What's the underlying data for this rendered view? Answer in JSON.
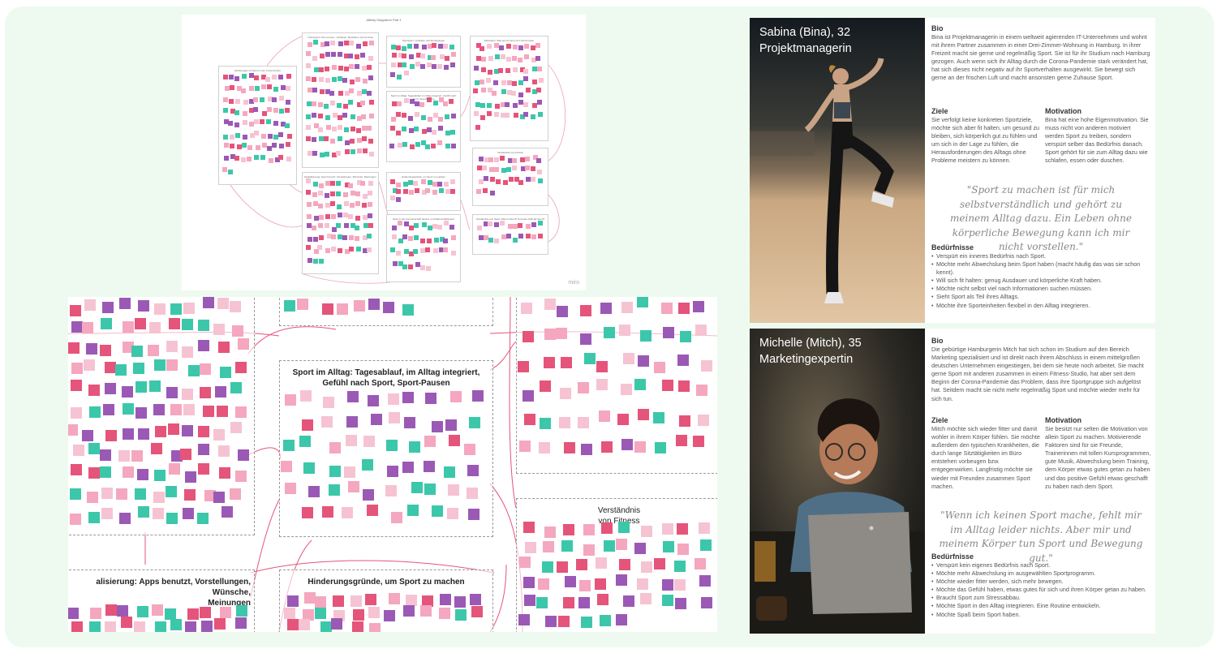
{
  "overview": {
    "title": "Affinity Diagramm Part 1",
    "watermark": "miro",
    "clusters": [
      {
        "label": "Erfahrungen mit Sport in der Covid-19-Zeit"
      },
      {
        "label": "Trainingsort: Wo und wie - Vorlieben, Motivation, Hemmnisse"
      },
      {
        "label": "Sportarten: Vorlieben und Abneigungen"
      },
      {
        "label": "Motivation: Was spornt einen an? Hemmnisse"
      },
      {
        "label": "Sport im Alltag: Tagesablauf, im Alltag integriert, Gefühl nach Sport, Sport-Pausen"
      },
      {
        "label": "Verständnis von Fitness"
      },
      {
        "label": "Digitalisierung: Apps benutzt, Vorstellungen, Wünsche, Meinungen"
      },
      {
        "label": "Hinderungsgründe, um Sport zu machen"
      },
      {
        "label": "Sport in der Gemeinschaft: Einzel- und Mannschaftssport"
      },
      {
        "label": "Verständnis von Sport: Was ist Sport? Und was zählt als Sport?"
      }
    ]
  },
  "zoom": {
    "clusters": [
      {
        "label": "Sport im Alltag: Tagesablauf, im Alltag integriert, Gefühl nach Sport, Sport-Pausen"
      },
      {
        "label": "Verständnis\nvon Fitness"
      },
      {
        "label": "alisierung: Apps benutzt, Vorstellungen, Wünsche,\nMeinungen"
      },
      {
        "label": "Hinderungsgründe, um Sport zu machen"
      }
    ]
  },
  "note_colors": [
    "#e5547a",
    "#f4a7bf",
    "#9b59b6",
    "#3cc7aa",
    "#f6c3d3"
  ],
  "personas": [
    {
      "name_line1": "Sabina (Bina), 32",
      "name_line2": "Projektmanagerin",
      "bio_heading": "Bio",
      "bio": "Bina ist Projektmanagerin in einem weltweit agierenden IT-Unternehmen und wohnt mit ihrem Partner zusammen in einer Drei-Zimmer-Wohnung in Hamburg. In ihrer Freizeit macht sie gerne und regelmäßig Sport. Sie ist für ihr Studium nach Hamburg gezogen. Auch wenn sich ihr Alltag durch die Corona-Pandemie stark verändert hat, hat sich dieses nicht negativ auf ihr Sportverhalten ausgewirkt. Sie bewegt sich gerne an der frischen Luft und macht ansonsten gerne Zuhause Sport.",
      "goals_heading": "Ziele",
      "goals": "Sie verfolgt keine konkreten Sportziele, möchte sich aber fit halten, um gesund zu bleiben, sich körperlich gut zu fühlen und um sich in der Lage zu fühlen, die Herausforderungen des Alltags ohne Probleme meistern zu können.",
      "motivation_heading": "Motivation",
      "motivation": "Bina hat eine hohe Eigenmotivation. Sie muss nicht von anderen motiviert werden Sport zu treiben, sondern verspürt selber das Bedürfnis danach. Sport gehört für sie zum Alltag dazu wie schlafen, essen oder duschen.",
      "quote": "\"Sport zu machen ist für mich selbstverständlich und gehört zu meinem Alltag dazu. Ein Leben ohne körperliche Bewegung kann ich mir nicht vorstellen.\"",
      "needs_heading": "Bedürfnisse",
      "needs": [
        "Verspürt ein inneres Bedürfnis nach Sport.",
        "Möchte mehr Abwechslung beim Sport haben (macht häufig das was sie schon kennt).",
        "Will sich fit halten: genug Ausdauer und körperliche Kraft haben.",
        "Möchte nicht selbst viel nach Informationen suchen müssen.",
        "Sieht Sport als Teil ihres Alltags.",
        "Möchte ihre Sporteinheiten flexibel in den Alltag integrieren."
      ]
    },
    {
      "name_line1": "Michelle (Mitch), 35",
      "name_line2": "Marketingexpertin",
      "bio_heading": "Bio",
      "bio": "Die gebürtige Hamburgerin Mitch hat sich schon im Studium auf den Bereich Marketing spezialisiert und ist direkt nach ihrem Abschluss in einem mittelgroßen deutschen Unternehmen eingestiegen, bei dem sie heute noch arbeitet. Sie macht gerne Sport mit anderen zusammen in einem Fitness-Studio, hat aber seit dem Beginn der Corona-Pandemie das Problem, dass ihre Sportgruppe sich aufgelöst hat. Seitdem macht sie nicht mehr regelmäßig Sport und möchte wieder mehr für sich tun.",
      "goals_heading": "Ziele",
      "goals": "Mitch möchte sich wieder fitter und damit wohler in ihrem Körper fühlen. Sie möchte außerdem den typischen Krankheiten, die durch lange Sitztätigkeiten im Büro entstehen vorbeugen bzw. entgegenwirken. Langfristig möchte sie wieder mit Freunden zusammen Sport machen.",
      "motivation_heading": "Motivation",
      "motivation": "Sie besitzt nur selten die Motivation von allein Sport zu machen. Motivierende Faktoren sind für sie Freunde, Trainerinnen mit tollen Kursprogrammen, gute Musik, Abwechslung beim Training, dem Körper etwas gutes getan zu haben und das positive Gefühl etwas geschafft zu haben nach dem Sport.",
      "quote": "\"Wenn ich keinen Sport mache, fehlt mir im Alltag leider nichts. Aber mir und meinem Körper tun Sport und Bewegung gut.\"",
      "needs_heading": "Bedürfnisse",
      "needs": [
        "Verspürt kein eigenes Bedürfnis nach Sport.",
        "Möchte mehr Abwechslung im ausgewählten Sportprogramm.",
        "Möchte wieder fitter werden, sich mehr bewegen.",
        "Möchte das Gefühl haben, etwas gutes für sich und ihren Körper getan zu haben.",
        "Braucht Sport zum Stressabbau.",
        "Möchte Sport in den Alltag integrieren. Eine Routine entwickeln.",
        "Möchte Spaß beim Sport haben."
      ]
    }
  ]
}
